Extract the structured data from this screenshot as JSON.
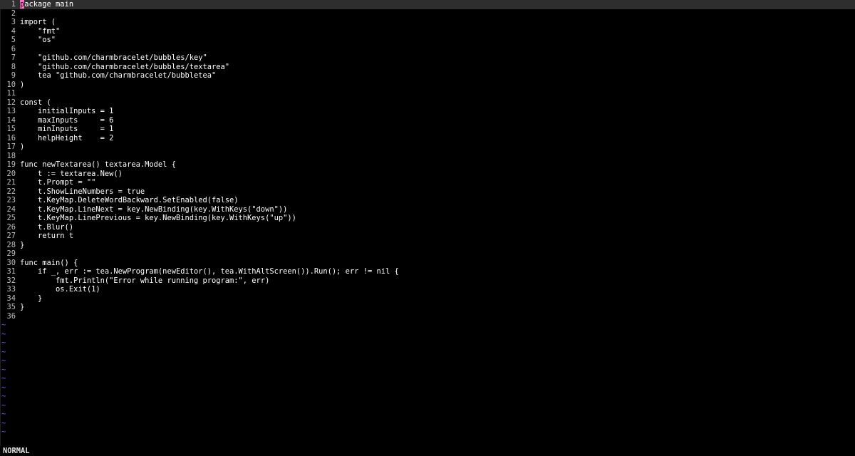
{
  "status": {
    "mode": "NORMAL"
  },
  "cursor": {
    "line": 1,
    "col": 1
  },
  "total_visible_rows": 49,
  "code_lines": [
    "package main",
    "",
    "import (",
    "    \"fmt\"",
    "    \"os\"",
    "",
    "    \"github.com/charmbracelet/bubbles/key\"",
    "    \"github.com/charmbracelet/bubbles/textarea\"",
    "    tea \"github.com/charmbracelet/bubbletea\"",
    ")",
    "",
    "const (",
    "    initialInputs = 1",
    "    maxInputs     = 6",
    "    minInputs     = 1",
    "    helpHeight    = 2",
    ")",
    "",
    "func newTextarea() textarea.Model {",
    "    t := textarea.New()",
    "    t.Prompt = \"\"",
    "    t.ShowLineNumbers = true",
    "    t.KeyMap.DeleteWordBackward.SetEnabled(false)",
    "    t.KeyMap.LineNext = key.NewBinding(key.WithKeys(\"down\"))",
    "    t.KeyMap.LinePrevious = key.NewBinding(key.WithKeys(\"up\"))",
    "    t.Blur()",
    "    return t",
    "}",
    "",
    "func main() {",
    "    if _, err := tea.NewProgram(newEditor(), tea.WithAltScreen()).Run(); err != nil {",
    "        fmt.Println(\"Error while running program:\", err)",
    "        os.Exit(1)",
    "    }",
    "}",
    ""
  ],
  "tilde_char": "~"
}
